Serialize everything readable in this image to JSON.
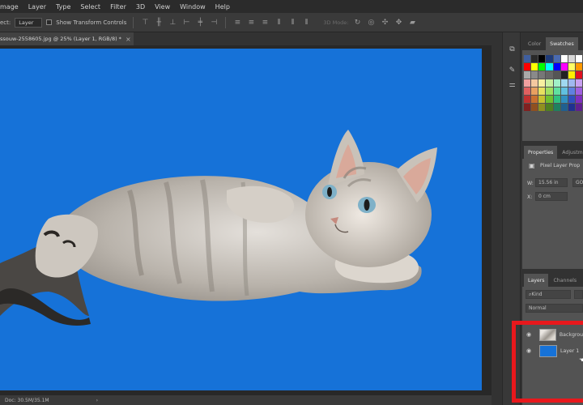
{
  "menu": [
    "mage",
    "Layer",
    "Type",
    "Select",
    "Filter",
    "3D",
    "View",
    "Window",
    "Help"
  ],
  "options": {
    "tool_label": "ect:",
    "select_value": "Layer",
    "transform_label": "Show Transform Controls",
    "mode_3d": "3D Mode:"
  },
  "document": {
    "tab_title": "ssouw-2558605.jpg @ 25% (Layer 1, RGB/8) *",
    "close_glyph": "×",
    "canvas_color": "#1672d8"
  },
  "status": {
    "doc_info": "Doc: 30.5M/35.1M",
    "arrow": "›"
  },
  "color_panel": {
    "tabs": [
      "Color",
      "Swatches"
    ],
    "active_tab": "Swatches",
    "swatch_rows": [
      [
        "#3f5f9f",
        "#2a2a2a",
        "#000000",
        "#1e3a78",
        "#4a6ab0",
        "#ffffff",
        "#d8d8d8",
        "#ffffff"
      ],
      [
        "#ff0000",
        "#ffff00",
        "#00ff00",
        "#00ffff",
        "#0000ff",
        "#ff00ff",
        "#ffff66",
        "#ff9900"
      ],
      [
        "#aaaaaa",
        "#8a8a8a",
        "#777777",
        "#666666",
        "#555555",
        "#222222",
        "#ffee00",
        "#e01020"
      ],
      [
        "#f0a0a0",
        "#f4c8a0",
        "#f8f0a0",
        "#c8f0a0",
        "#a0f0c8",
        "#a0d8f0",
        "#a0b8f0",
        "#c8a0f0"
      ],
      [
        "#e06060",
        "#e8a060",
        "#e8e060",
        "#a0e060",
        "#60e0a0",
        "#60c0e0",
        "#6080e0",
        "#a060e0"
      ],
      [
        "#c03030",
        "#c87030",
        "#c8c030",
        "#70c030",
        "#30c080",
        "#3090c0",
        "#3050c0",
        "#8030c0"
      ],
      [
        "#802020",
        "#905020",
        "#909020",
        "#508020",
        "#208060",
        "#206090",
        "#203090",
        "#602090"
      ]
    ]
  },
  "properties": {
    "tabs": [
      "Properties",
      "Adjustme"
    ],
    "active_tab": "Properties",
    "title": "Pixel Layer Prop",
    "w_label": "W:",
    "w_value": "15.56 in",
    "link_text": "GO",
    "x_label": "X:",
    "x_value": "0 cm"
  },
  "layers": {
    "tabs": [
      "Layers",
      "Channels"
    ],
    "active_tab": "Layers",
    "kind_label": "Kind",
    "blend_mode": "Normal",
    "items": [
      {
        "name": "Backgrou",
        "visible_glyph": "◉",
        "thumb": "cat"
      },
      {
        "name": "Layer 1",
        "visible_glyph": "◉",
        "thumb": "blue"
      }
    ]
  },
  "highlight_color": "#e8181c"
}
